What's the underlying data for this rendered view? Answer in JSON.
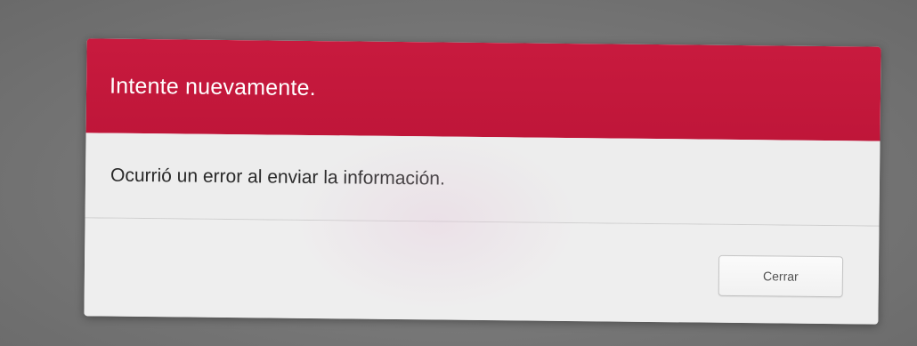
{
  "dialog": {
    "title": "Intente nuevamente.",
    "message": "Ocurrió un error al enviar la información.",
    "close_label": "Cerrar"
  },
  "colors": {
    "header_bg": "#c81a3e",
    "header_text": "#ffffff",
    "body_bg": "#ededed",
    "overlay_bg": "#7b7b7b"
  }
}
